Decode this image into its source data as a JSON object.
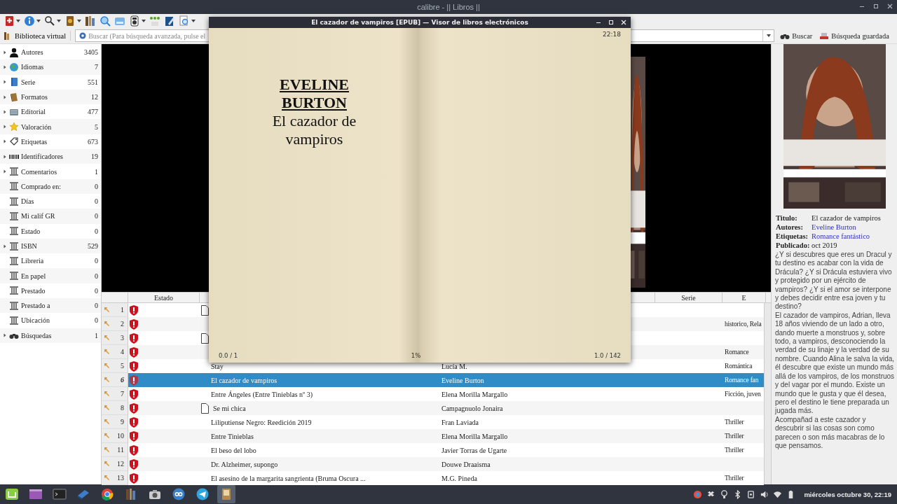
{
  "window": {
    "title": "calibre - || Libros ||"
  },
  "search_bar": {
    "virtual_library": "Biblioteca virtual",
    "placeholder": "Buscar (Para búsqueda avanzada, pulse el",
    "buttons": [
      "Buscar",
      "Búsqueda guardada"
    ]
  },
  "tag_browser": {
    "items": [
      {
        "kind": "user",
        "label": "Autores",
        "count": "3405",
        "expandable": true
      },
      {
        "kind": "globe",
        "label": "Idiomas",
        "count": "7",
        "expandable": true
      },
      {
        "kind": "book",
        "label": "Serie",
        "count": "551",
        "expandable": true
      },
      {
        "kind": "formats",
        "label": "Formatos",
        "count": "12",
        "expandable": true
      },
      {
        "kind": "publisher",
        "label": "Editorial",
        "count": "477",
        "expandable": true
      },
      {
        "kind": "star",
        "label": "Valoración",
        "count": "5",
        "expandable": true
      },
      {
        "kind": "tag",
        "label": "Etiquetas",
        "count": "673",
        "expandable": true
      },
      {
        "kind": "barcode",
        "label": "Identificadores",
        "count": "19",
        "expandable": true
      },
      {
        "kind": "column",
        "label": "Comentarios",
        "count": "1",
        "expandable": true
      },
      {
        "kind": "column",
        "label": "Comprado en:",
        "count": "0",
        "expandable": false
      },
      {
        "kind": "column",
        "label": "Días",
        "count": "0",
        "expandable": false
      },
      {
        "kind": "column",
        "label": "Mi calif GR",
        "count": "0",
        "expandable": false
      },
      {
        "kind": "column",
        "label": "Estado",
        "count": "0",
        "expandable": false
      },
      {
        "kind": "column",
        "label": "ISBN",
        "count": "529",
        "expandable": true
      },
      {
        "kind": "column",
        "label": "Libreria",
        "count": "0",
        "expandable": false
      },
      {
        "kind": "column",
        "label": "En papel",
        "count": "0",
        "expandable": false
      },
      {
        "kind": "column",
        "label": "Prestado",
        "count": "0",
        "expandable": false
      },
      {
        "kind": "column",
        "label": "Prestado a",
        "count": "0",
        "expandable": false
      },
      {
        "kind": "column",
        "label": "Ubicación",
        "count": "0",
        "expandable": false
      },
      {
        "kind": "binoculars",
        "label": "Búsquedas",
        "count": "1",
        "expandable": true
      }
    ]
  },
  "book_list": {
    "columns": [
      "Estado",
      "Serie",
      "E"
    ],
    "rows": [
      {
        "number": "1",
        "note": true,
        "selected": false
      },
      {
        "number": "2",
        "note": false,
        "tags": "historico, Rela",
        "selected": false
      },
      {
        "number": "3",
        "note": true,
        "selected": false
      },
      {
        "number": "4",
        "note": false,
        "tags": "Romance",
        "selected": false
      },
      {
        "number": "5",
        "note": false,
        "title": "Stay",
        "author": "Lucía M.",
        "tags": "Romántica",
        "selected": false
      },
      {
        "number": "6",
        "note": false,
        "title": "El cazador de vampiros",
        "author": "Eveline Burton",
        "tags": "Romance fan",
        "selected": true
      },
      {
        "number": "7",
        "note": false,
        "title": "Entre Ángeles (Entre Tinieblas nº 3)",
        "author": "Elena Morilla Margallo",
        "tags": "Ficción, juven",
        "selected": false
      },
      {
        "number": "8",
        "note": true,
        "title": "Se mi chica",
        "author": "Campagnuolo Jonaira",
        "selected": false
      },
      {
        "number": "9",
        "note": false,
        "title": "Liliputiense Negro: Reedición 2019",
        "author": "Fran Laviada",
        "tags": "Thriller",
        "selected": false
      },
      {
        "number": "10",
        "note": false,
        "title": "Entre Tinieblas",
        "author": "Elena Morilla Margallo",
        "tags": "Thriller",
        "selected": false
      },
      {
        "number": "11",
        "note": false,
        "title": "El beso del lobo",
        "author": "Javier Torras de Ugarte",
        "tags": "Thriller",
        "selected": false
      },
      {
        "number": "12",
        "note": false,
        "title": "Dr. Alzheimer, supongo",
        "author": "Douwe Draaisma",
        "selected": false
      },
      {
        "number": "13",
        "note": false,
        "title": "El asesino de la margarita sangrienta (Bruma Oscura ...",
        "author": "M.G. Pineda",
        "tags": "Thriller",
        "selected": false
      }
    ]
  },
  "book_details": {
    "fields": [
      {
        "label": "Titulo:",
        "value": "El cazador de vampiros",
        "kind": "text"
      },
      {
        "label": "Autores:",
        "value": "Eveline Burton",
        "kind": "link"
      },
      {
        "label": "Etiquetas:",
        "value": "Romance fantástico",
        "kind": "link"
      },
      {
        "label": "Publicado:",
        "value": "oct 2019",
        "kind": "text"
      }
    ],
    "description": [
      "¿Y si descubres que eres un Dracul y tu destino es acabar con la vida de Drácula? ¿Y si Drácula estuviera vivo y protegido por un ejército de vampiros? ¿Y si el amor se interpone y debes decidir entre esa joven y tu destino?",
      "El cazador de vampiros, Adrian, lleva 18 años viviendo de un lado a otro, dando muerte a monstruos y, sobre todo, a vampiros, desconociendo la verdad de su linaje y la verdad de su nombre. Cuando Alina le salva la vida, él descubre que existe un mundo más allá de los vampiros, de los monstruos y del vagar por el mundo. Existe un mundo que le gusta y que él desea, pero el destino le tiene preparada un jugada más.",
      "Acompañad a este cazador y descubrir si las cosas son como parecen o son más macabras de lo que pensamos."
    ]
  },
  "viewer": {
    "title": "El cazador de vampiros [EPUB] — Visor de libros electrónicos",
    "clock": "22:18",
    "author": "EVELINE BURTON",
    "book_title": "El cazador de vampiros",
    "position": "0.0 / 1",
    "percent": "1%",
    "page": "1.0 / 142"
  },
  "taskbar": {
    "apps": [
      {
        "kind": "mint",
        "active": false
      },
      {
        "kind": "purple",
        "active": false
      },
      {
        "kind": "terminal",
        "active": false
      },
      {
        "kind": "bluebook",
        "active": false
      },
      {
        "kind": "chrome",
        "active": false
      },
      {
        "kind": "books",
        "active": false
      },
      {
        "kind": "camera",
        "active": false
      },
      {
        "kind": "qb",
        "active": false
      },
      {
        "kind": "telegram",
        "active": false
      },
      {
        "kind": "calibre",
        "active": true
      }
    ],
    "clock": "miércoles octubre 30, 22:19"
  }
}
